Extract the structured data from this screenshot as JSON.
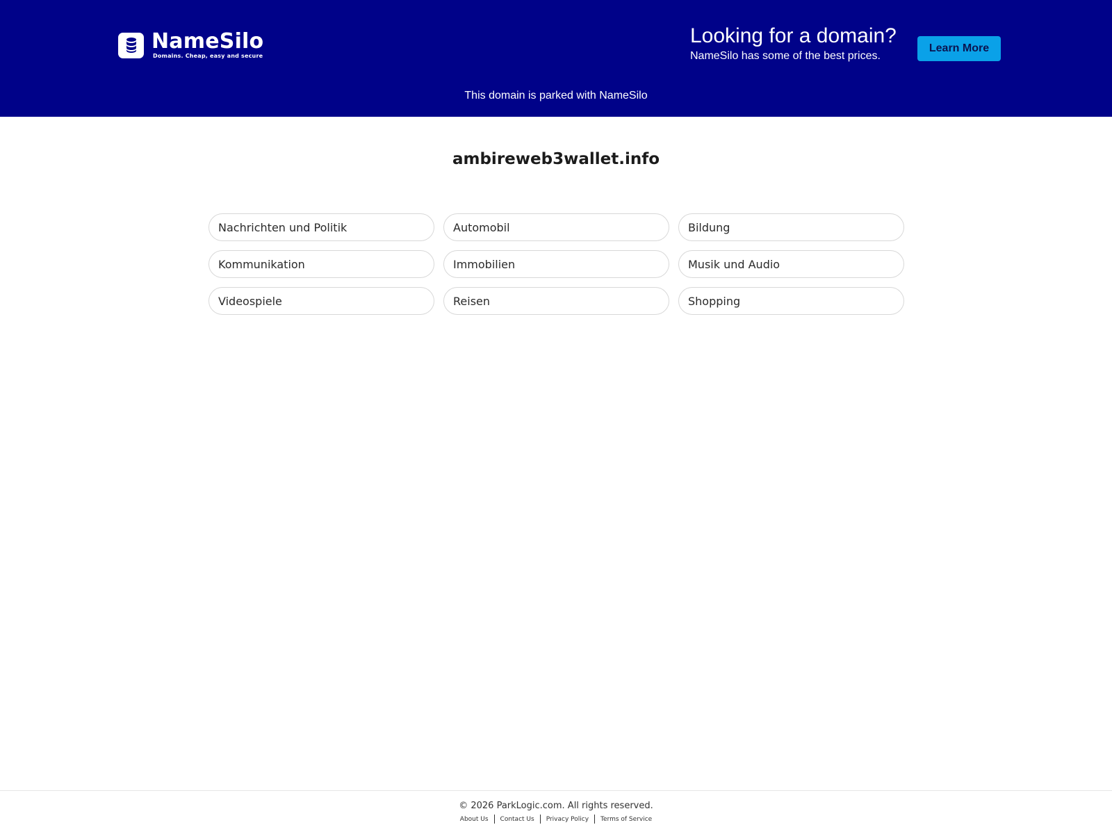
{
  "header": {
    "brand": "NameSilo",
    "tagline": "Domains. Cheap, easy and secure",
    "promo_title": "Looking for a domain?",
    "promo_subtitle": "NameSilo has some of the best prices.",
    "learn_more_label": "Learn More",
    "parked_notice": "This domain is parked with NameSilo"
  },
  "domain": "ambireweb3wallet.info",
  "links": [
    "Nachrichten und Politik",
    "Automobil",
    "Bildung",
    "Kommunikation",
    "Immobilien",
    "Musik und Audio",
    "Videospiele",
    "Reisen",
    "Shopping"
  ],
  "footer": {
    "copyright": "© 2026 ParkLogic.com. All rights reserved.",
    "links": [
      "About Us",
      "Contact Us",
      "Privacy Policy",
      "Terms of Service"
    ]
  },
  "colors": {
    "header_bg": "#000289",
    "button_bg": "#0aa1e8"
  }
}
